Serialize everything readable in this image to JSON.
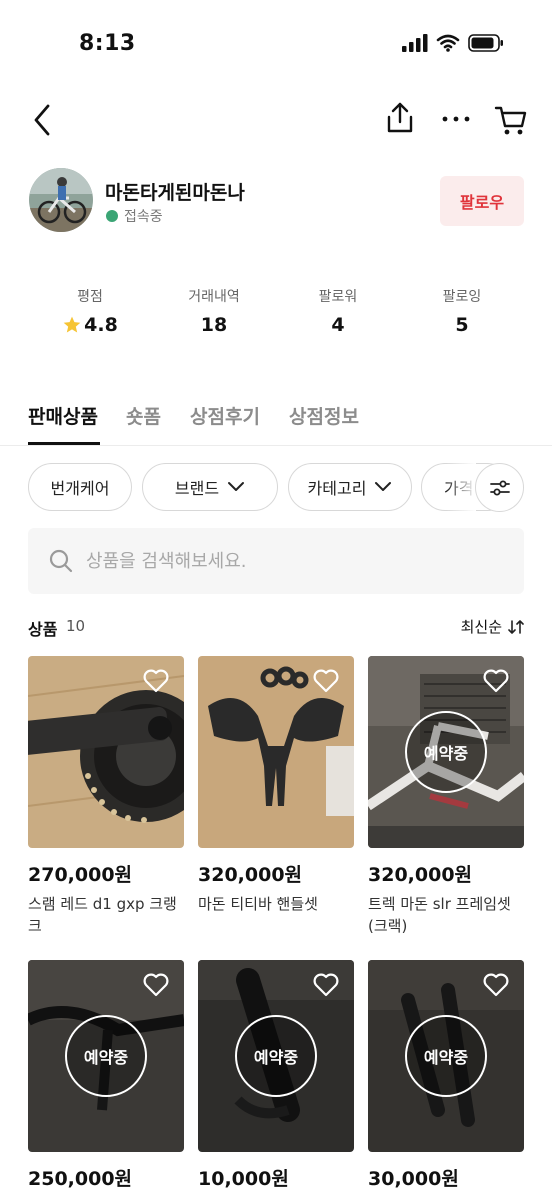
{
  "status_bar": {
    "time": "8:13"
  },
  "nav": {
    "back_icon": "chevron-left-icon",
    "share_icon": "share-icon",
    "more_icon": "more-horizontal-icon",
    "cart_icon": "cart-icon"
  },
  "profile": {
    "shop_name": "마돈타게된마돈나",
    "status": "접속중",
    "status_color": "#3ba575",
    "follow_label": "팔로우",
    "follow_color": "#e0343b"
  },
  "stats": [
    {
      "label": "평점",
      "value": "4.8",
      "icon": "star-icon"
    },
    {
      "label": "거래내역",
      "value": "18"
    },
    {
      "label": "팔로워",
      "value": "4"
    },
    {
      "label": "팔로잉",
      "value": "5"
    }
  ],
  "tabs": [
    {
      "label": "판매상품",
      "active": true
    },
    {
      "label": "숏폼"
    },
    {
      "label": "상점후기"
    },
    {
      "label": "상점정보"
    }
  ],
  "filters": {
    "chips": [
      {
        "label": "번개케어"
      },
      {
        "label": "브랜드"
      },
      {
        "label": "카테고리"
      },
      {
        "label": "가격"
      }
    ],
    "settings_icon": "filter-settings-icon"
  },
  "search": {
    "placeholder": "상품을 검색해보세요."
  },
  "products_header": {
    "title": "상품",
    "count": "10",
    "sort_label": "최신순"
  },
  "products": [
    {
      "price": "270,000원",
      "name": "스램 레드 d1 gxp 크랭크",
      "reserved": false
    },
    {
      "price": "320,000원",
      "name": "마돈 티티바 핸들셋",
      "reserved": false
    },
    {
      "price": "320,000원",
      "name": "트렉 마돈 slr 프레임셋 (크랙)",
      "reserved": true,
      "reserved_label": "예약중"
    },
    {
      "price": "250,000원",
      "name": "",
      "reserved": true,
      "reserved_label": "예약중"
    },
    {
      "price": "10,000원",
      "name": "",
      "reserved": true,
      "reserved_label": "예약중"
    },
    {
      "price": "30,000원",
      "name": "",
      "reserved": true,
      "reserved_label": "예약중"
    }
  ]
}
